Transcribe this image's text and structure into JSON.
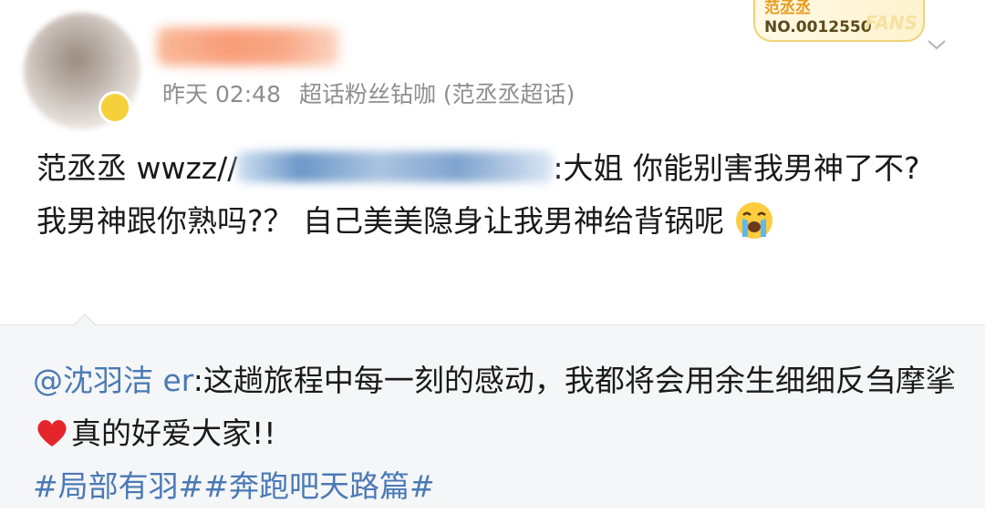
{
  "post": {
    "timestamp": "昨天 02:48",
    "source": "超话粉丝钻咖 (范丞丞超话)",
    "prefix": "范丞丞 wwzz//",
    "body": ":大姐  你能别害我男神了不? 我男神跟你熟吗?？  自己美美隐身让我男神给背锅呢",
    "emoji_icon": "loudly-crying-face-icon"
  },
  "fans_badge": {
    "name": "范丞丞",
    "number": "NO.0012550",
    "word": "FANS"
  },
  "repost": {
    "mention": "@沈羽洁 er",
    "text_before_heart": ":这趟旅程中每一刻的感动，我都将会用余生细细反刍摩挲",
    "text_after_heart": "真的好爱大家!!",
    "topics": "#局部有羽##奔跑吧天路篇#",
    "heart_icon": "red-heart-icon"
  },
  "colors": {
    "link": "#4a7ab5",
    "meta_text": "#8e8e8e",
    "repost_bg": "#f5f6f7",
    "badge_gold": "#e89a1a"
  }
}
